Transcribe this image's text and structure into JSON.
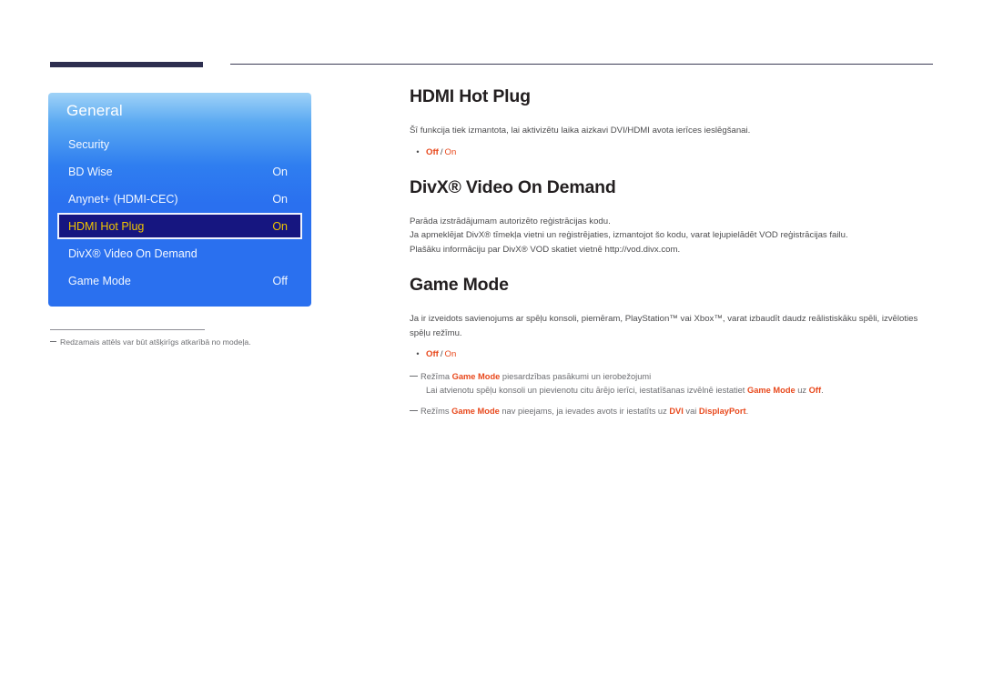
{
  "decor": {
    "thick_bar": "thick-navy-bar",
    "thin_rule": "thin-horizontal-rule"
  },
  "menu": {
    "title": "General",
    "items": [
      {
        "label": "Security",
        "value": "",
        "selected": false
      },
      {
        "label": "BD Wise",
        "value": "On",
        "selected": false
      },
      {
        "label": "Anynet+ (HDMI-CEC)",
        "value": "On",
        "selected": false
      },
      {
        "label": "HDMI Hot Plug",
        "value": "On",
        "selected": true
      },
      {
        "label": "DivX® Video On Demand",
        "value": "",
        "selected": false
      },
      {
        "label": "Game Mode",
        "value": "Off",
        "selected": false
      }
    ],
    "caption": "Redzamais attēls var būt atšķirīgs atkarībā no modeļa."
  },
  "sections": {
    "hdmi_hot_plug": {
      "title": "HDMI Hot Plug",
      "paragraph": "Šī funkcija tiek izmantota, lai aktivizētu laika aizkavi DVI/HDMI avota ierīces ieslēgšanai.",
      "option_off": "Off",
      "option_sep": "/",
      "option_on": "On"
    },
    "divx_vod": {
      "title": "DivX® Video On Demand",
      "line1": "Parāda izstrādājumam autorizēto reģistrācijas kodu.",
      "line2": "Ja apmeklējat DivX® tīmekļa vietni un reģistrējaties, izmantojot šo kodu, varat lejupielādēt VOD reģistrācijas failu.",
      "line3": "Plašāku informāciju par DivX® VOD skatiet vietnē http://vod.divx.com."
    },
    "game_mode": {
      "title": "Game Mode",
      "paragraph": "Ja ir izveidots savienojums ar spēļu konsoli, piemēram, PlayStation™ vai Xbox™, varat izbaudīt daudz reālistiskāku spēli, izvēloties spēļu režīmu.",
      "option_off": "Off",
      "option_sep": "/",
      "option_on": "On",
      "note1_pre": "Režīma ",
      "note1_term": "Game Mode",
      "note1_post": " piesardzības pasākumi un ierobežojumi",
      "note1_sub_pre": "Lai atvienotu spēļu konsoli un pievienotu citu ārējo ierīci, iestatīšanas izvēlnē iestatiet ",
      "note1_sub_term": "Game Mode",
      "note1_sub_mid": " uz ",
      "note1_sub_term2": "Off",
      "note1_sub_end": ".",
      "note2_pre": "Režīms ",
      "note2_term": "Game Mode",
      "note2_mid": " nav pieejams, ja ievades avots ir iestatīts uz ",
      "note2_term2": "DVI",
      "note2_mid2": " vai ",
      "note2_term3": "DisplayPort",
      "note2_end": "."
    }
  },
  "colors": {
    "accent_red": "#e8491d",
    "menu_blue": "#2a70ef",
    "selected_navy": "#161680",
    "selected_text": "#f0c400",
    "rule_navy": "#2e2f50"
  }
}
